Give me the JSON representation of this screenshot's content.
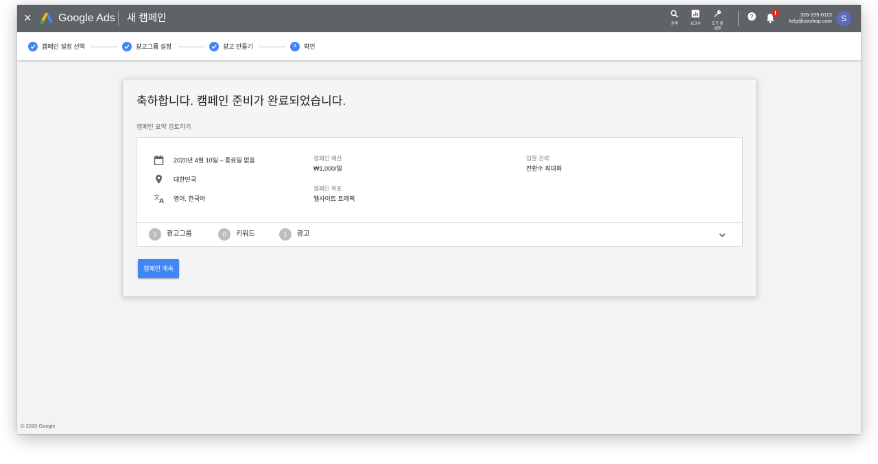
{
  "header": {
    "close_label": "×",
    "brand": "Google Ads",
    "title": "새 캠페인",
    "tools": [
      {
        "label": "검색",
        "icon": "search-icon"
      },
      {
        "label": "보고서",
        "icon": "report-icon"
      },
      {
        "label": "도구 및 설정",
        "icon": "wrench-icon"
      }
    ],
    "help_label": "?",
    "notification_badge": "!",
    "account_phone": "326-159-0115",
    "account_email": "help@sixshop.com",
    "avatar_letter": "S"
  },
  "stepper": {
    "steps": [
      {
        "label": "캠페인 설정 선택",
        "state": "done"
      },
      {
        "label": "광고그룹 설정",
        "state": "done"
      },
      {
        "label": "광고 만들기",
        "state": "done"
      },
      {
        "label": "확인",
        "state": "current",
        "number": "4"
      }
    ]
  },
  "card": {
    "title": "축하합니다. 캠페인 준비가 완료되었습니다.",
    "subtitle": "캠페인 요약 검토하기",
    "schedule": "2020년 4월 10일 – 종료일 없음",
    "location": "대한민국",
    "languages": "영어, 한국어",
    "budget_label": "캠페인 예산",
    "budget_value": "₩1,000/일",
    "goal_label": "캠페인 목표",
    "goal_value": "웹사이트 트래픽",
    "bidding_label": "입찰 전략",
    "bidding_value": "전환수 최대화",
    "stats": [
      {
        "count": "1",
        "label": "광고그룹"
      },
      {
        "count": "0",
        "label": "키워드"
      },
      {
        "count": "1",
        "label": "광고"
      }
    ],
    "continue_button": "캠페인 계속"
  },
  "footer": {
    "copyright": "© 2020 Google"
  },
  "colors": {
    "header_bg": "#5f6368",
    "accent": "#4285f4",
    "badge": "#d93025",
    "avatar": "#5c6bc0"
  }
}
